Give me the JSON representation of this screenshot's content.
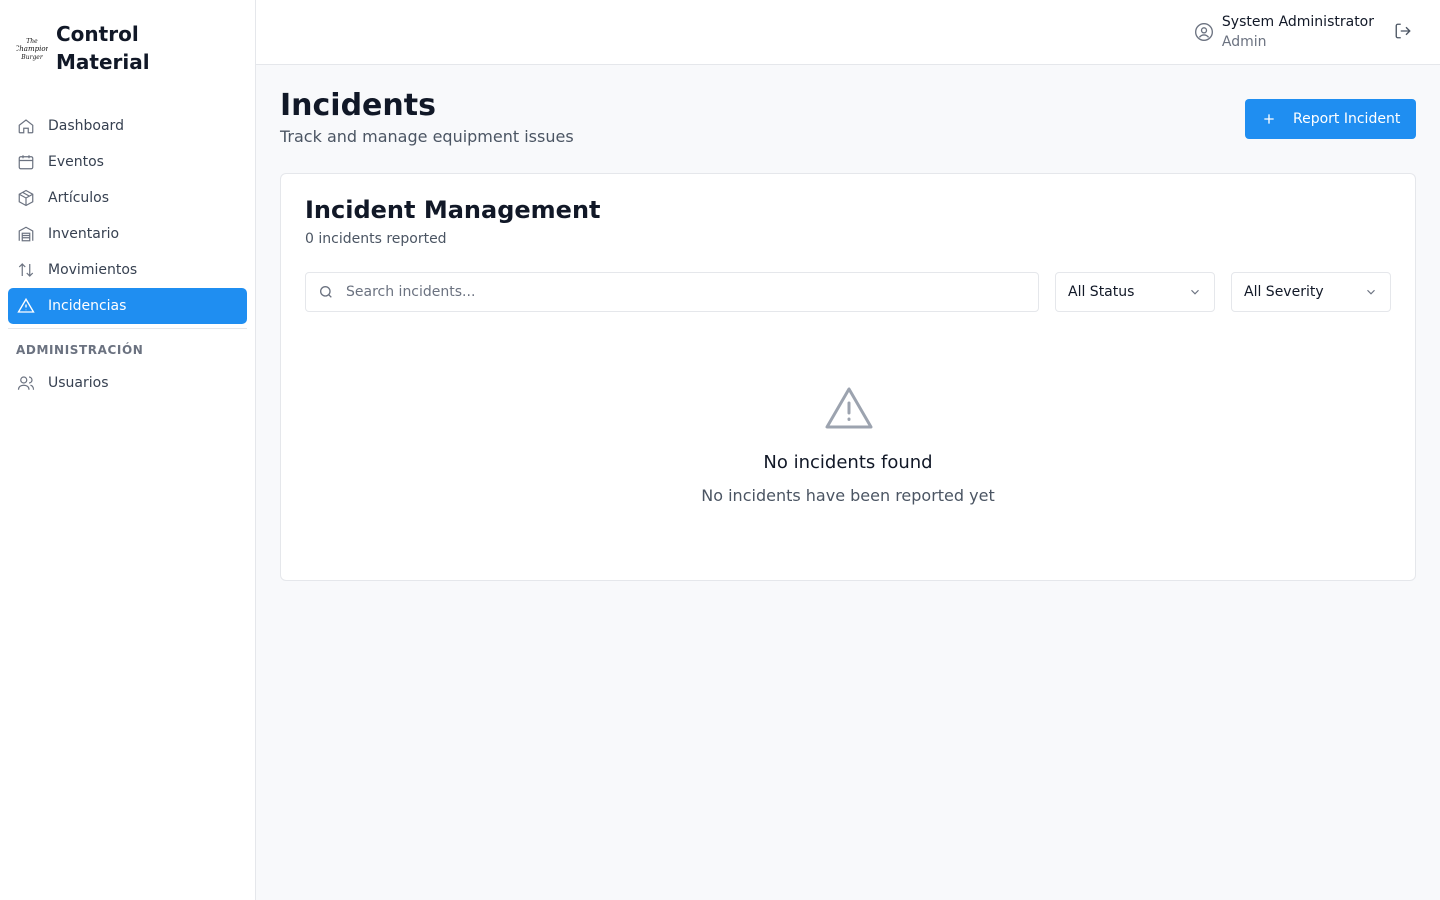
{
  "brand": {
    "title": "Control\nMaterial",
    "logo_icon": "the-champion-burger-logo"
  },
  "sidebar": {
    "items": [
      {
        "label": "Dashboard",
        "icon": "home-icon"
      },
      {
        "label": "Eventos",
        "icon": "calendar-icon"
      },
      {
        "label": "Artículos",
        "icon": "box-icon"
      },
      {
        "label": "Inventario",
        "icon": "warehouse-icon"
      },
      {
        "label": "Movimientos",
        "icon": "arrows-up-down-icon"
      },
      {
        "label": "Incidencias",
        "icon": "warning-triangle-icon",
        "active": true
      }
    ],
    "section_label": "ADMINISTRACIÓN",
    "admin_items": [
      {
        "label": "Usuarios",
        "icon": "users-icon"
      }
    ]
  },
  "header": {
    "user_name": "System Administrator",
    "user_role": "Admin"
  },
  "page": {
    "title": "Incidents",
    "subtitle": "Track and manage equipment issues",
    "report_button": "Report Incident"
  },
  "card": {
    "title": "Incident Management",
    "count_text": "0 incidents reported",
    "search_placeholder": "Search incidents...",
    "status_filter": "All Status",
    "severity_filter": "All Severity",
    "empty_title": "No incidents found",
    "empty_subtitle": "No incidents have been reported yet"
  },
  "colors": {
    "accent": "#1f8ef1",
    "border": "#e5e7eb",
    "muted": "#6b7280"
  }
}
